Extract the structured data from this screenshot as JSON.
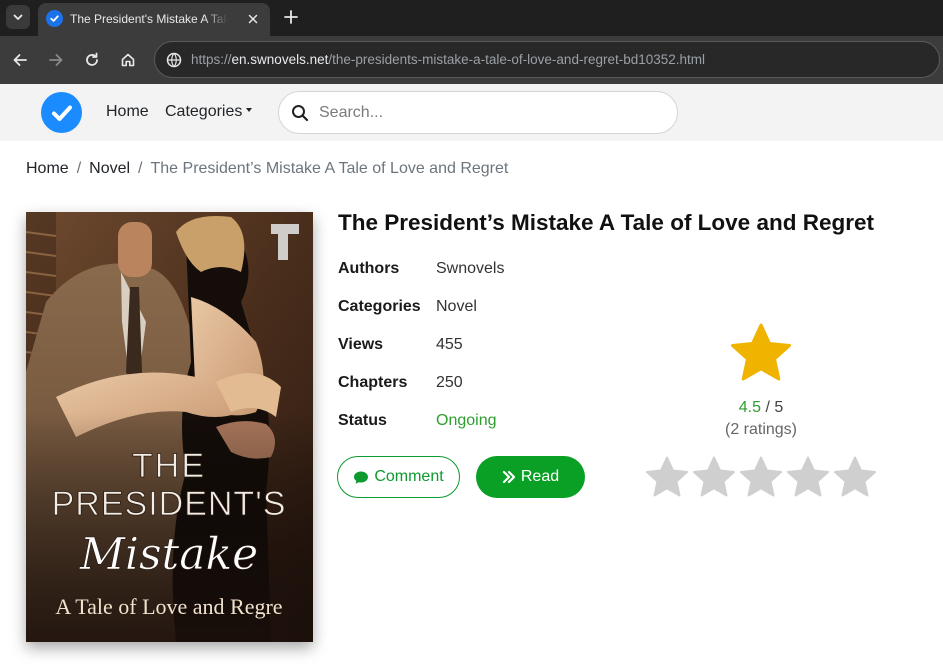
{
  "browser": {
    "tab_title": "The President's Mistake A Tale of Love and Regret",
    "url_prefix": "https://",
    "url_host": "en.swnovels.net",
    "url_path": "/the-presidents-mistake-a-tale-of-love-and-regret-bd10352.html"
  },
  "header": {
    "nav": {
      "home": "Home",
      "categories": "Categories"
    },
    "search_placeholder": "Search..."
  },
  "breadcrumb": {
    "items": [
      "Home",
      "Novel"
    ],
    "separator": "/",
    "current": "The President’s Mistake A Tale of Love and Regret"
  },
  "cover": {
    "line1": "THE",
    "line2": "PRESIDENT'S",
    "line3": "Mistake",
    "line4": "A Tale of Love and Regre"
  },
  "book": {
    "title": "The President’s Mistake A Tale of Love and Regret",
    "meta": [
      {
        "label": "Authors",
        "value": "Swnovels"
      },
      {
        "label": "Categories",
        "value": "Novel"
      },
      {
        "label": "Views",
        "value": "455"
      },
      {
        "label": "Chapters",
        "value": "250"
      },
      {
        "label": "Status",
        "value": "Ongoing"
      }
    ],
    "buttons": {
      "comment": "Comment",
      "read": "Read"
    }
  },
  "rating": {
    "score": "4.5",
    "max": "/ 5",
    "count": "(2 ratings)",
    "stars_total": 5,
    "colors": {
      "star_filled": "#f0b400",
      "star_empty": "#cfcfcf",
      "score": "#2e9e2e"
    }
  }
}
